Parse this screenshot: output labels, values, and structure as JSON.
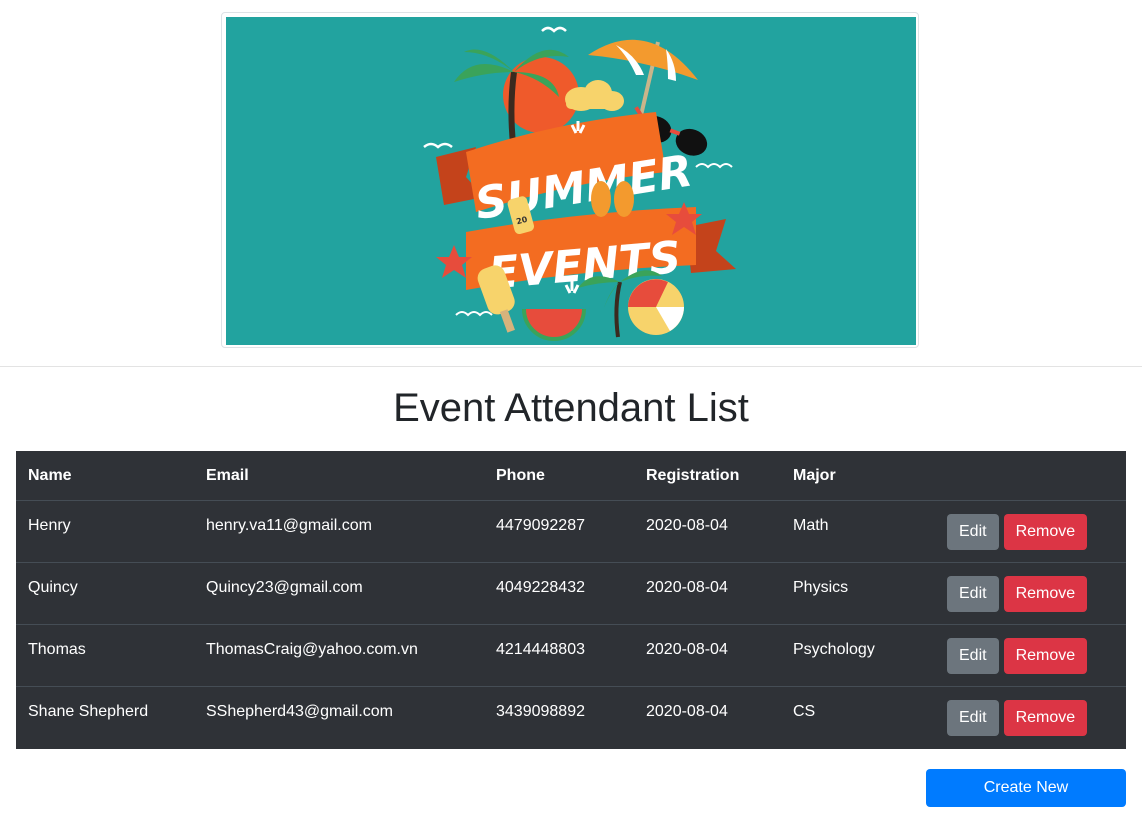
{
  "banner": {
    "line1": "SUMMER",
    "line2": "EVENTS",
    "sunscreen_label": "20",
    "background_color": "#22a39f",
    "ribbon_color": "#f36c21"
  },
  "page": {
    "title": "Event Attendant List"
  },
  "table": {
    "headers": [
      "Name",
      "Email",
      "Phone",
      "Registration",
      "Major",
      ""
    ],
    "rows": [
      {
        "name": "Henry",
        "email": "henry.va11@gmail.com",
        "phone": "4479092287",
        "registration": "2020-08-04",
        "major": "Math"
      },
      {
        "name": "Quincy",
        "email": "Quincy23@gmail.com",
        "phone": "4049228432",
        "registration": "2020-08-04",
        "major": "Physics"
      },
      {
        "name": "Thomas",
        "email": "ThomasCraig@yahoo.com.vn",
        "phone": "4214448803",
        "registration": "2020-08-04",
        "major": "Psychology"
      },
      {
        "name": "Shane Shepherd",
        "email": "SShepherd43@gmail.com",
        "phone": "3439098892",
        "registration": "2020-08-04",
        "major": "CS"
      }
    ],
    "edit_label": "Edit",
    "remove_label": "Remove"
  },
  "actions": {
    "create_label": "Create New"
  },
  "colors": {
    "table_bg": "#2f3237",
    "edit": "#6c757d",
    "remove": "#dc3545",
    "create": "#007bff"
  }
}
